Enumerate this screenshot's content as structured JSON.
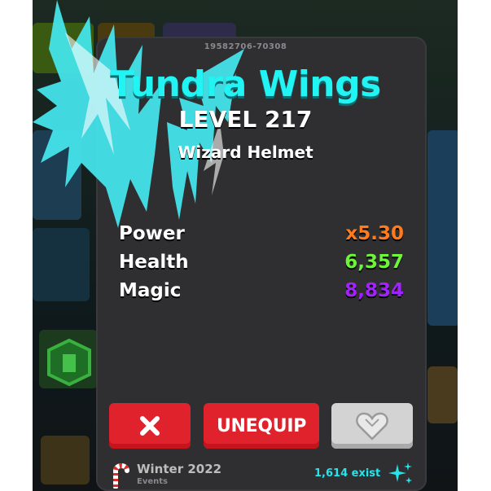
{
  "item": {
    "id": "19582706-70308",
    "name": "Tundra Wings",
    "level": "LEVEL 217",
    "type": "Wizard Helmet"
  },
  "stats": [
    {
      "label": "Power",
      "value": "x5.30",
      "color": "#ff7b1c"
    },
    {
      "label": "Health",
      "value": "6,357",
      "color": "#6ef43a"
    },
    {
      "label": "Magic",
      "value": "8,834",
      "color": "#a321ff"
    }
  ],
  "buttons": {
    "close_icon": "close-x-icon",
    "unequip_label": "UNEQUIP",
    "favorite_icon": "heart-icon"
  },
  "footer": {
    "event_name": "Winter 2022",
    "event_sub": "Events",
    "event_icon": "candy-cane-icon",
    "exist_count": "1,614 exist",
    "exist_icon": "sparkle-icon"
  },
  "colors": {
    "name": "#22f3f3",
    "card": "#2f2f31",
    "button_red": "#e0222c",
    "button_gray": "#d3d3d3",
    "exist": "#25e5ec"
  }
}
